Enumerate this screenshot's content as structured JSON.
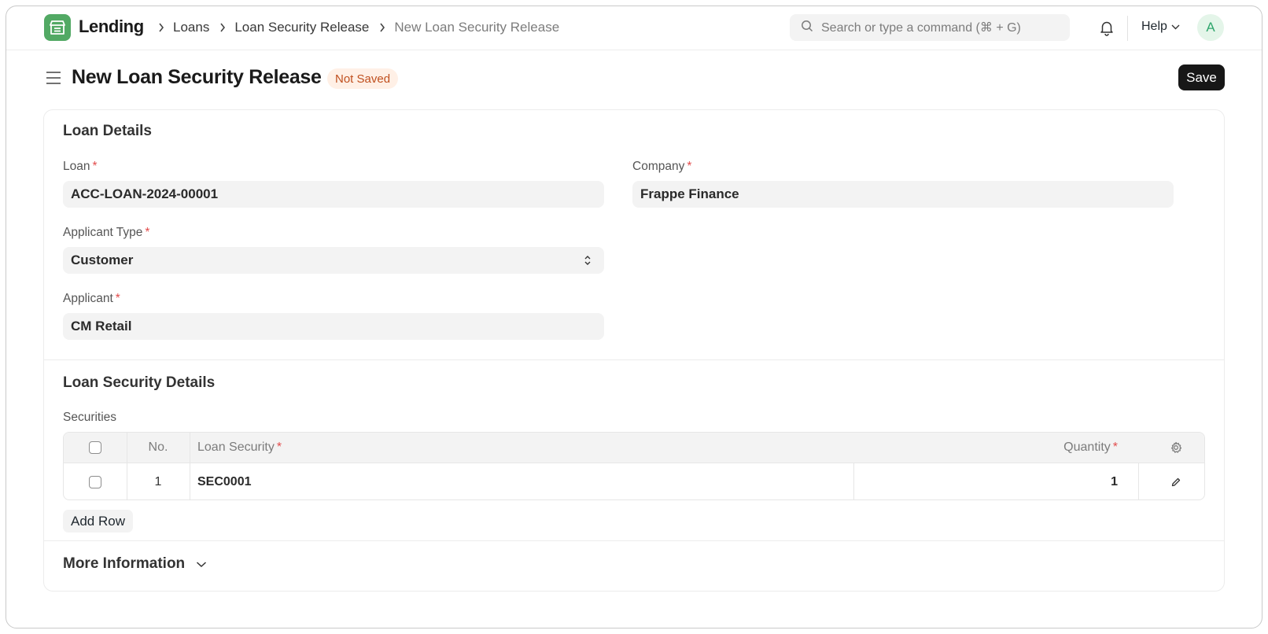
{
  "navbar": {
    "app_name": "Lending",
    "breadcrumbs": [
      "Loans",
      "Loan Security Release",
      "New Loan Security Release"
    ],
    "search_placeholder": "Search or type a command (⌘ + G)",
    "help_label": "Help",
    "avatar_initial": "A"
  },
  "page": {
    "title": "New Loan Security Release",
    "status": "Not Saved",
    "save_label": "Save"
  },
  "loan_details": {
    "title": "Loan Details",
    "loan": {
      "label": "Loan",
      "value": "ACC-LOAN-2024-00001"
    },
    "company": {
      "label": "Company",
      "value": "Frappe Finance"
    },
    "applicant_type": {
      "label": "Applicant Type",
      "value": "Customer"
    },
    "applicant": {
      "label": "Applicant",
      "value": "CM Retail"
    }
  },
  "security_details": {
    "title": "Loan Security Details",
    "table_label": "Securities",
    "columns": {
      "no": "No.",
      "loan_security": "Loan Security",
      "quantity": "Quantity"
    },
    "rows": [
      {
        "no": "1",
        "loan_security": "SEC0001",
        "quantity": "1"
      }
    ],
    "add_row_label": "Add Row"
  },
  "more_information": {
    "title": "More Information"
  },
  "colors": {
    "brand_green": "#52a964",
    "badge_bg": "#fff0e6",
    "badge_text": "#c0501f",
    "primary_button": "#171717",
    "required_star": "#e24c4c"
  },
  "icons": [
    "app-logo-icon",
    "chevron-right-icon",
    "search-icon",
    "bell-icon",
    "chevron-down-icon",
    "hamburger-icon",
    "select-caret-icon",
    "settings-gear-icon",
    "edit-pencil-icon"
  ]
}
